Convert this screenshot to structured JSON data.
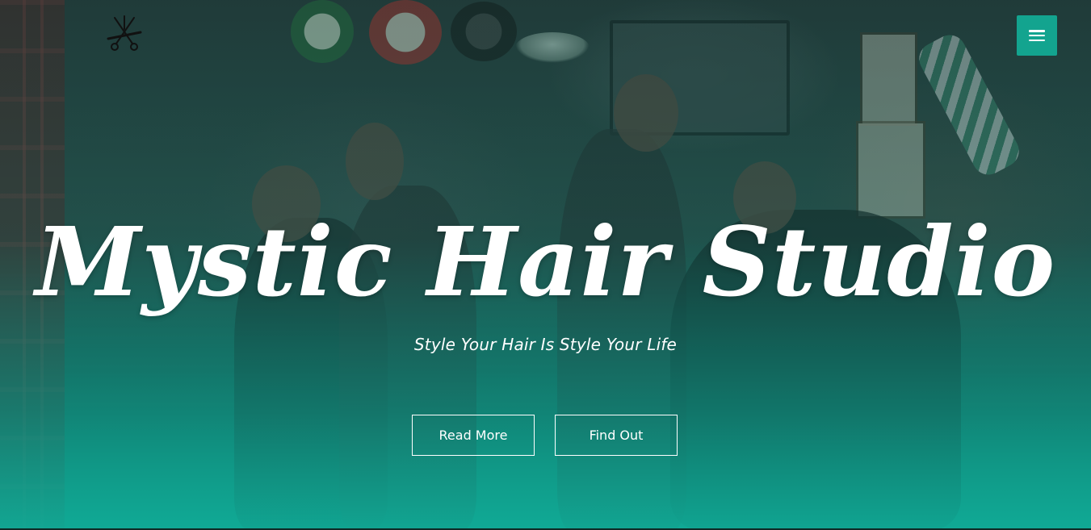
{
  "header": {
    "logo_icon": "scissors-comb-icon",
    "menu_icon": "hamburger-menu-icon"
  },
  "hero": {
    "title": "Mystic Hair Studio",
    "subtitle": "Style Your Hair Is Style Your Life",
    "buttons": {
      "read_more": "Read More",
      "find_out": "Find Out"
    }
  },
  "colors": {
    "accent": "#13a48f",
    "overlay_bottom": "#10aa96",
    "text": "#ffffff"
  }
}
